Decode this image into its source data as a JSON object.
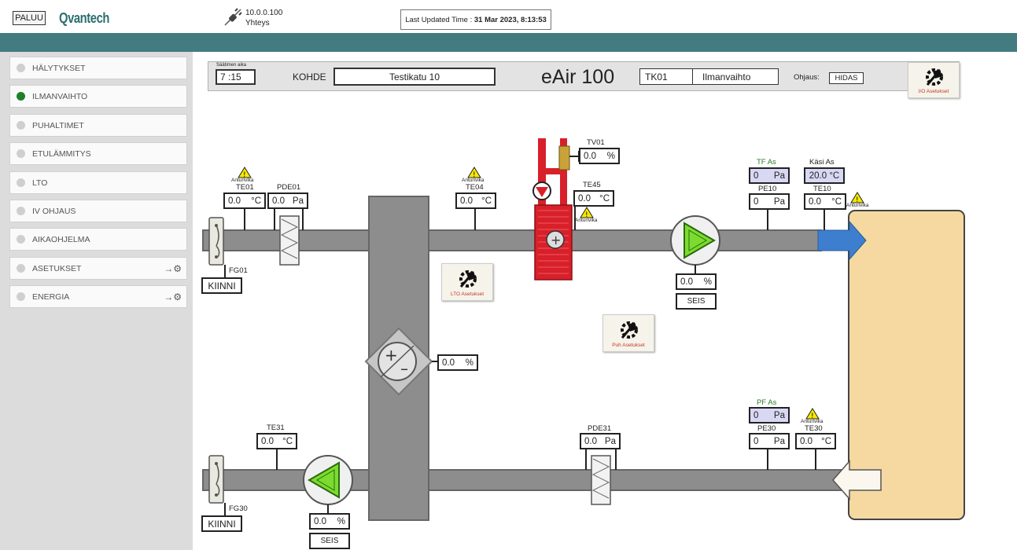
{
  "header": {
    "back_label": "PALUU",
    "brand": "Qvantech",
    "connection_ip": "10.0.0.100",
    "connection_label": "Yhteys",
    "last_updated_prefix": "Last Updated Time : ",
    "last_updated_value": "31 Mar 2023, 8:13:53"
  },
  "sidebar": {
    "items": [
      {
        "label": "HÄLYTYKSET",
        "active": false
      },
      {
        "label": "ILMANVAIHTO",
        "active": true
      },
      {
        "label": "PUHALTIMET",
        "active": false
      },
      {
        "label": "ETULÄMMITYS",
        "active": false
      },
      {
        "label": "LTO",
        "active": false
      },
      {
        "label": "IV OHJAUS",
        "active": false
      },
      {
        "label": "AIKAOHJELMA",
        "active": false
      },
      {
        "label": "ASETUKSET",
        "active": false
      },
      {
        "label": "ENERGIA",
        "active": false
      }
    ]
  },
  "strip": {
    "time_label": "Säätimen aika",
    "time_value": "7 :15",
    "kohde_label": "KOHDE",
    "kohde_value": "Testikatu 10",
    "model": "eAir 100",
    "unit_id": "TK01",
    "unit_name": "Ilmanvaihto",
    "ohjaus_label": "Ohjaus:",
    "ohjaus_value": "HIDAS",
    "io_settings": "I/O Asetukset"
  },
  "diagram": {
    "warning_text": "Anturivika",
    "te01": {
      "label": "TE01",
      "value": "0.0",
      "unit": "°C"
    },
    "pde01": {
      "label": "PDE01",
      "value": "0.0",
      "unit": "Pa"
    },
    "fg01": {
      "label": "FG01",
      "state": "KIINNI"
    },
    "te04": {
      "label": "TE04",
      "value": "0.0",
      "unit": "°C"
    },
    "tv01": {
      "label": "TV01",
      "value": "0.0",
      "unit": "%"
    },
    "te45": {
      "label": "TE45",
      "value": "0.0",
      "unit": "°C"
    },
    "tf_as": {
      "label": "TF As",
      "value": "0",
      "unit": "Pa"
    },
    "pe10": {
      "label": "PE10",
      "value": "0",
      "unit": "Pa"
    },
    "kasi_as": {
      "label": "Käsi As",
      "value": "20.0 °C"
    },
    "te10": {
      "label": "TE10",
      "value": "0.0",
      "unit": "°C"
    },
    "supply_fan": {
      "value": "0.0",
      "unit": "%",
      "state": "SEIS"
    },
    "lto_settings": "LTO Asetukset",
    "puh_settings": "Puh Asetukset",
    "hrc": {
      "value": "0.0",
      "unit": "%"
    },
    "pf_as": {
      "label": "PF As",
      "value": "0",
      "unit": "Pa"
    },
    "pe30": {
      "label": "PE30",
      "value": "0",
      "unit": "Pa"
    },
    "te30": {
      "label": "TE30",
      "value": "0.0",
      "unit": "°C"
    },
    "te31": {
      "label": "TE31",
      "value": "0.0",
      "unit": "°C"
    },
    "pde31": {
      "label": "PDE31",
      "value": "0.0",
      "unit": "Pa"
    },
    "fg30": {
      "label": "FG30",
      "state": "KIINNI"
    },
    "exhaust_fan": {
      "value": "0.0",
      "unit": "%",
      "state": "SEIS"
    }
  },
  "colors": {
    "teal": "#437c80",
    "active_dot": "#1f7f2a",
    "fan_green": "#7bdc2f",
    "heater_red": "#d8202a",
    "supply_arrow": "#3d7fce",
    "room": "#f5d9a0",
    "setpoint_box": "#d8d8f4"
  },
  "icons": [
    "plug-icon",
    "chevron-down-icon",
    "gear-wrench-icon",
    "warning-icon",
    "arrow-gear-icon"
  ]
}
